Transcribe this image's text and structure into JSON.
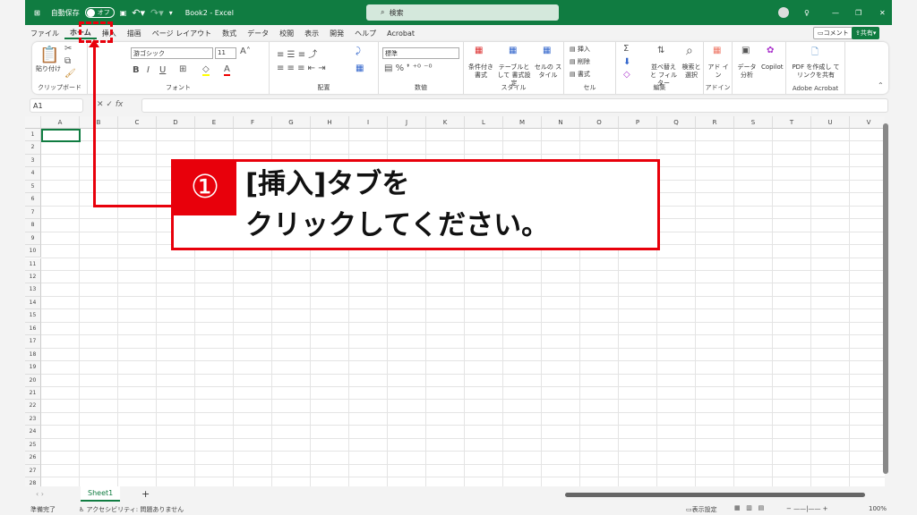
{
  "title": {
    "autosave": "自動保存",
    "toggle": "オフ",
    "doc": "Book2 - Excel",
    "search": "検索"
  },
  "tabs": [
    "ファイル",
    "ホーム",
    "挿入",
    "描画",
    "ページ レイアウト",
    "数式",
    "データ",
    "校閲",
    "表示",
    "開発",
    "ヘルプ",
    "Acrobat"
  ],
  "active_tab": "ホーム",
  "comment_btn": "コメント",
  "share_btn": "共有",
  "ribbon": {
    "clipboard": {
      "label": "クリップボード",
      "paste": "貼り付け"
    },
    "font": {
      "label": "フォント",
      "name": "游ゴシック",
      "size": "11"
    },
    "align": {
      "label": "配置"
    },
    "number": {
      "label": "数値",
      "format": "標準"
    },
    "styles": {
      "label": "スタイル",
      "items": [
        "条件付き 書式",
        "テーブルとして 書式設定",
        "セルの スタイル"
      ]
    },
    "cells": {
      "label": "セル",
      "items": [
        "挿入",
        "削除",
        "書式"
      ]
    },
    "edit": {
      "label": "編集",
      "items": [
        "並べ替えと フィルター",
        "検索と 選択"
      ]
    },
    "addins": {
      "label": "アドイン",
      "item": "アド イン"
    },
    "analysis": {
      "item": "データ 分析",
      "copilot": "Copilot"
    },
    "acrobat": {
      "label": "Adobe Acrobat",
      "item": "PDF を作成し てリンクを共有"
    }
  },
  "namebox": "A1",
  "columns": [
    "A",
    "B",
    "C",
    "D",
    "E",
    "F",
    "G",
    "H",
    "I",
    "J",
    "K",
    "L",
    "M",
    "N",
    "O",
    "P",
    "Q",
    "R",
    "S",
    "T",
    "U",
    "V"
  ],
  "rows": 28,
  "sheet_tab": "Sheet1",
  "status": {
    "ready": "準備完了",
    "accessibility": "アクセシビリティ: 問題ありません",
    "display": "表示設定",
    "zoom": "100%"
  },
  "annotation": {
    "number": "①",
    "line1": "[挿入]タブを",
    "line2": "クリックしてください。"
  },
  "colors": {
    "excel_green": "#107c41",
    "annotation_red": "#e8000b"
  }
}
